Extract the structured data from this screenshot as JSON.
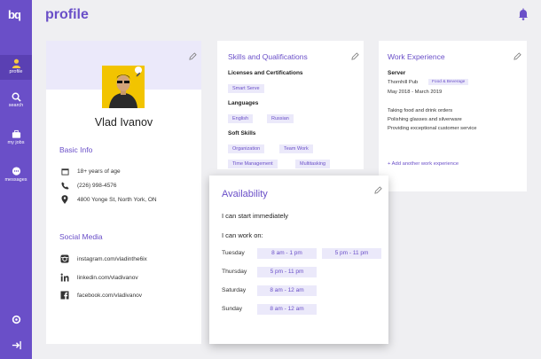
{
  "app": {
    "logo": "bq",
    "page_title": "profile"
  },
  "sidebar": {
    "items": [
      {
        "label": "profile",
        "icon": "user-icon"
      },
      {
        "label": "search",
        "icon": "search-icon"
      },
      {
        "label": "my jobs",
        "icon": "briefcase-icon"
      },
      {
        "label": "messages",
        "icon": "chat-icon"
      }
    ],
    "bottom": [
      {
        "icon": "settings-icon"
      },
      {
        "icon": "logout-icon"
      }
    ]
  },
  "profile": {
    "name": "Vlad Ivanov",
    "basic_info_title": "Basic Info",
    "age": "18+ years of age",
    "phone": "(226) 998-4576",
    "address": "4800 Yonge St, North York, ON",
    "social_title": "Social Media",
    "instagram": "instagram.com/vladinthe6ix",
    "linkedin": "linkedin.com/vladivanov",
    "facebook": "facebook.com/vladivanov"
  },
  "skills": {
    "title": "Skills and Qualifications",
    "licenses_label": "Licenses and Certifications",
    "licenses": [
      "Smart Serve"
    ],
    "languages_label": "Languages",
    "languages": [
      "English",
      "Russian"
    ],
    "soft_label": "Soft Skills",
    "soft": [
      "Organization",
      "Team Work",
      "Time Management",
      "Multitasking"
    ]
  },
  "work": {
    "title": "Work Experience",
    "role": "Server",
    "employer": "Thornhill Pub",
    "category": "Food & Beverage",
    "dates": "May 2018 - March 2019",
    "duties": [
      "Taking food and drink orders",
      "Polishing glasses and silverware",
      "Providing exceptional customer service"
    ],
    "add_link": "+ Add another work experience"
  },
  "availability": {
    "title": "Availability",
    "start": "I can start immediately",
    "work_on": "I can work on:",
    "days": [
      {
        "day": "Tuesday",
        "slots": [
          "8 am - 1 pm",
          "5 pm - 11 pm"
        ]
      },
      {
        "day": "Thursday",
        "slots": [
          "5 pm - 11 pm"
        ]
      },
      {
        "day": "Saturday",
        "slots": [
          "8 am - 12 am"
        ]
      },
      {
        "day": "Sunday",
        "slots": [
          "8 am - 12 am"
        ]
      }
    ]
  },
  "colors": {
    "accent": "#6a4fc8",
    "tag_bg": "#ebe9fa",
    "avatar_bg": "#f2c400"
  }
}
